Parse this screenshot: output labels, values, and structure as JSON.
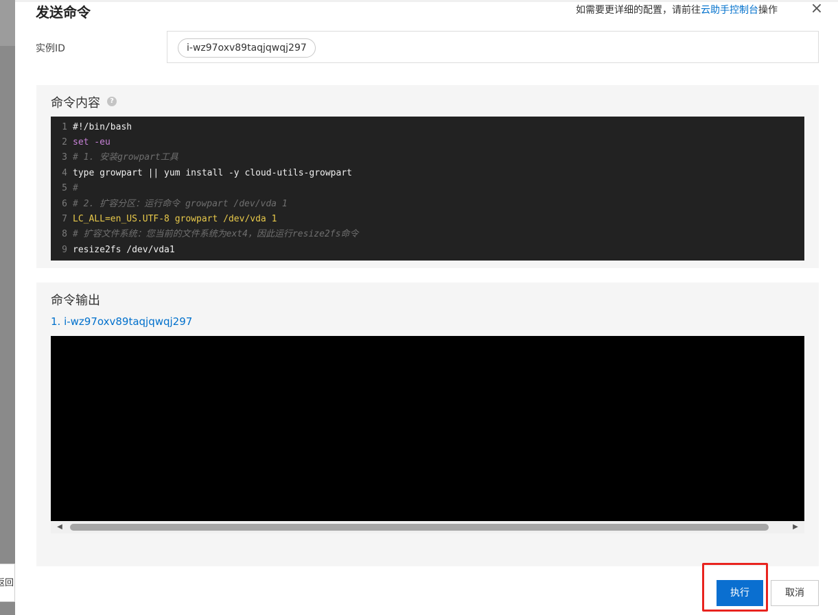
{
  "background": {
    "button_label": "返回"
  },
  "dialog": {
    "title": "发送命令",
    "hint_prefix": "如需要更详细的配置，请前往",
    "hint_link": "云助手控制台",
    "hint_suffix": "操作",
    "close_icon": "×"
  },
  "instance": {
    "label": "实例ID",
    "chip": "i-wz97oxv89taqjqwqj297"
  },
  "command": {
    "title": "命令内容",
    "help_icon": "?",
    "lines": [
      "#!/bin/bash",
      "set -eu",
      "# 1. 安装growpart工具",
      "type growpart || yum install -y cloud-utils-growpart",
      "#",
      "# 2. 扩容分区：运行命令 growpart /dev/vda 1",
      "LC_ALL=en_US.UTF-8 growpart /dev/vda 1",
      "# 扩容文件系统：您当前的文件系统为ext4，因此运行resize2fs命令",
      "resize2fs /dev/vda1"
    ]
  },
  "output": {
    "title": "命令输出",
    "item": "1.   i-wz97oxv89taqjqwqj297"
  },
  "buttons": {
    "execute": "执行",
    "cancel": "取消"
  },
  "colors": {
    "primary": "#0a6fd0",
    "link": "#0070cc",
    "highlight": "#e8231e",
    "editor_bg": "#222222"
  }
}
